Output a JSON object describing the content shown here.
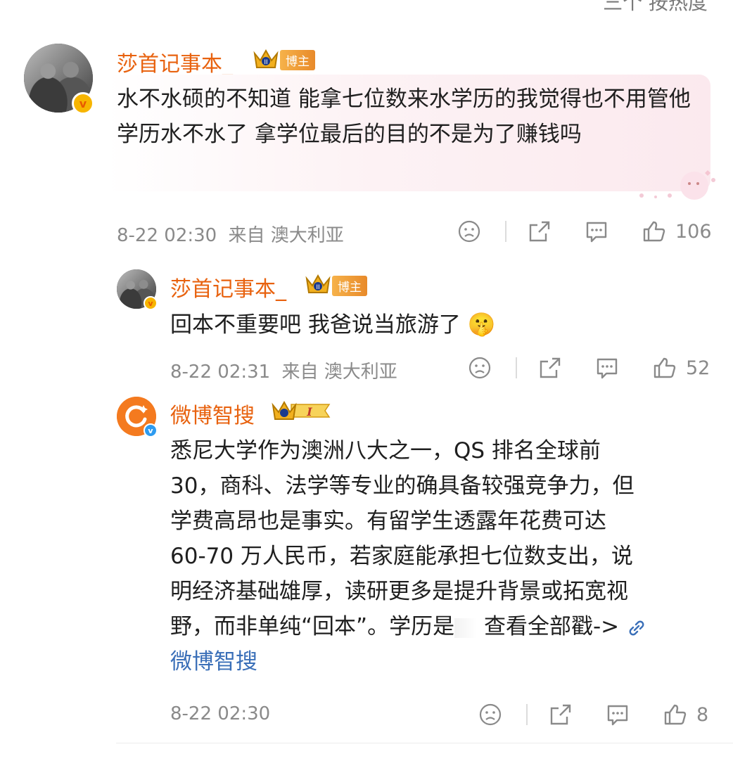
{
  "header": {
    "partial_text": "三个 按热度"
  },
  "comment1": {
    "username": "莎首记事本_",
    "badge": "博主",
    "text": "水不水硕的不知道 能拿七位数来水学历的我觉得也不用管他学历水不水了 拿学位最后的目的不是为了赚钱吗",
    "time": "8-22 02:30",
    "source": "来自 澳大利亚",
    "likes": "106"
  },
  "reply1": {
    "username": "莎首记事本_",
    "badge": "博主",
    "text": "回本不重要吧 我爸说当旅游了",
    "emoji": "🤫",
    "time": "8-22 02:31",
    "source": "来自 澳大利亚",
    "likes": "52"
  },
  "reply2": {
    "username": "微博智搜",
    "level": "I",
    "text_lines": [
      "悉尼大学作为澳洲八大之一，QS 排名全球前",
      "30，商科、法学等专业的确具备较强竞争力，但",
      "学费高昂也是事实。有留学生透露年花费可达",
      "60-70 万人民币，若家庭能承担七位数支出，说",
      "明经济基础雄厚，读研更多是提升背景或拓宽视",
      "野，而非单纯“回本”。学历是"
    ],
    "more_link": "查看全部戳->",
    "signature": "微博智搜",
    "time": "8-22 02:30",
    "likes": "8"
  },
  "colors": {
    "username": "#e8620f",
    "meta": "#8a8a8a",
    "link": "#3a6fb8"
  }
}
